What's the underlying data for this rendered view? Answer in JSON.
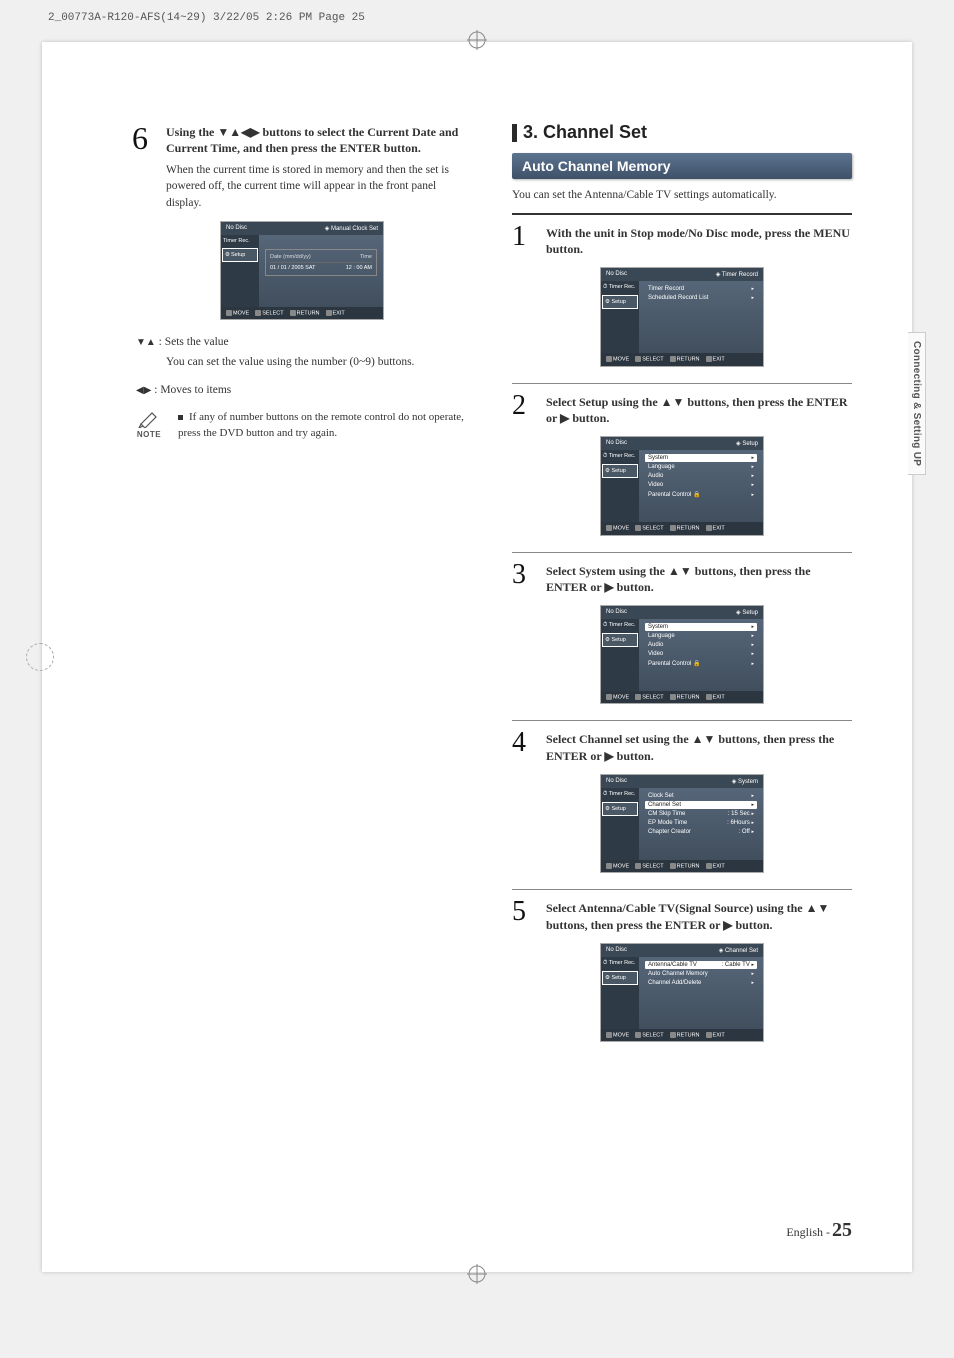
{
  "print_header": "2_00773A-R120-AFS(14~29)  3/22/05  2:26 PM  Page 25",
  "side_tab": "Connecting & Setting UP",
  "page_footer": {
    "lang": "English -",
    "num": "25"
  },
  "left": {
    "step6": {
      "num": "6",
      "bold": "Using the ▼▲◀▶ buttons to select the Current Date and Current Time, and then press the ENTER button.",
      "desc": "When the current time is stored in memory and then the set is powered off, the current time will appear in the front panel display."
    },
    "osd_clock": {
      "no_disc": "No Disc",
      "title": "Manual Clock Set",
      "side": [
        "Timer Rec.",
        "Setup"
      ],
      "date_label": "Date (mm/dd/yy)",
      "time_label": "Time",
      "date_val": "01 / 01 / 2005  SAT",
      "time_val": "12 : 00  AM",
      "footer": [
        "MOVE",
        "SELECT",
        "RETURN",
        "EXIT"
      ]
    },
    "anno1_sym": "▼▲",
    "anno1_txt": ": Sets the value",
    "anno1_desc": "You can set the value using the number (0~9) buttons.",
    "anno2_sym": "◀▶",
    "anno2_txt": ": Moves to items",
    "note_label": "NOTE",
    "note_text": "If any of number buttons on the remote control do not operate, press the DVD button and try again."
  },
  "right": {
    "section_num": "3.",
    "section_title": "Channel Set",
    "subhead": "Auto Channel Memory",
    "intro": "You can set the Antenna/Cable TV settings automatically.",
    "step1": {
      "num": "1",
      "bold": "With the unit in Stop mode/No Disc mode, press the MENU button."
    },
    "step2": {
      "num": "2",
      "bold": "Select Setup using the ▲▼ buttons, then press the ENTER or ▶ button."
    },
    "step3": {
      "num": "3",
      "bold": "Select System using the ▲▼ buttons, then press the ENTER or ▶ button."
    },
    "step4": {
      "num": "4",
      "bold": "Select Channel set using the ▲▼ buttons, then press the ENTER or ▶ button."
    },
    "step5": {
      "num": "5",
      "bold": "Select Antenna/Cable TV(Signal Source) using the ▲▼ buttons, then press the ENTER or ▶ button."
    },
    "osd1": {
      "no_disc": "No Disc",
      "title": "Timer Record",
      "side": [
        "Timer Rec.",
        "Setup"
      ],
      "rows": [
        [
          "Timer Record",
          ""
        ],
        [
          "Scheduled Record List",
          ""
        ]
      ],
      "footer": [
        "MOVE",
        "SELECT",
        "RETURN",
        "EXIT"
      ]
    },
    "osd2": {
      "no_disc": "No Disc",
      "title": "Setup",
      "side": [
        "Timer Rec.",
        "Setup"
      ],
      "rows": [
        [
          "System",
          ""
        ],
        [
          "Language",
          ""
        ],
        [
          "Audio",
          ""
        ],
        [
          "Video",
          ""
        ],
        [
          "Parental Control  🔒",
          ""
        ]
      ],
      "hi": 0,
      "footer": [
        "MOVE",
        "SELECT",
        "RETURN",
        "EXIT"
      ]
    },
    "osd3": {
      "no_disc": "No Disc",
      "title": "Setup",
      "side": [
        "Timer Rec.",
        "Setup"
      ],
      "rows": [
        [
          "System",
          ""
        ],
        [
          "Language",
          ""
        ],
        [
          "Audio",
          ""
        ],
        [
          "Video",
          ""
        ],
        [
          "Parental Control  🔒",
          ""
        ]
      ],
      "hi": 0,
      "footer": [
        "MOVE",
        "SELECT",
        "RETURN",
        "EXIT"
      ]
    },
    "osd4": {
      "no_disc": "No Disc",
      "title": "System",
      "side": [
        "Timer Rec.",
        "Setup"
      ],
      "rows": [
        [
          "Clock Set",
          ""
        ],
        [
          "Channel Set",
          ""
        ],
        [
          "CM Skip Time",
          ": 15 Sec"
        ],
        [
          "EP Mode Time",
          ": 6Hours"
        ],
        [
          "Chapter Creator",
          ": Off"
        ]
      ],
      "hi": 1,
      "footer": [
        "MOVE",
        "SELECT",
        "RETURN",
        "EXIT"
      ]
    },
    "osd5": {
      "no_disc": "No Disc",
      "title": "Channel Set",
      "side": [
        "Timer Rec.",
        "Setup"
      ],
      "rows": [
        [
          "Antenna/Cable TV",
          ": Cable TV"
        ],
        [
          "Auto Channel Memory",
          ""
        ],
        [
          "Channel Add/Delete",
          ""
        ]
      ],
      "hi": 0,
      "footer": [
        "MOVE",
        "SELECT",
        "RETURN",
        "EXIT"
      ]
    }
  }
}
